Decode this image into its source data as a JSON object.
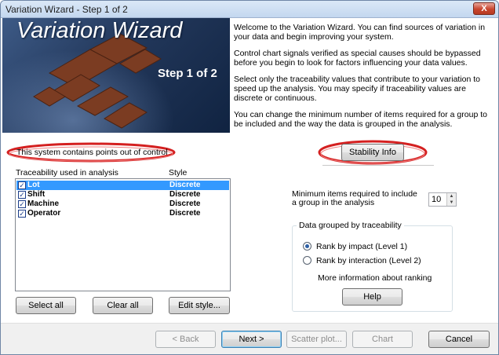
{
  "window": {
    "title": "Variation Wizard - Step 1 of 2",
    "close_glyph": "X"
  },
  "banner": {
    "title": "Variation Wizard",
    "step": "Step 1 of 2"
  },
  "intro": {
    "paragraphs": [
      "Welcome to the Variation Wizard.  You can find sources of variation in your data and begin improving your system.",
      "Control chart signals verified as special causes should be bypassed before you begin to look for factors influencing your data values.",
      "Select only the traceability values that contribute to your variation to speed up the analysis.  You may specify if traceability values are discrete or continuous.",
      "You can change the minimum number of items required for a group to be included and the way the data is grouped in the analysis."
    ]
  },
  "status": {
    "out_of_control": "This system contains points out of control"
  },
  "stability": {
    "button_label": "Stability Info"
  },
  "traceability": {
    "header_name": "Traceability used in analysis",
    "header_style": "Style",
    "items": [
      {
        "name": "Lot",
        "style": "Discrete",
        "checked": true,
        "selected": true
      },
      {
        "name": "Shift",
        "style": "Discrete",
        "checked": true,
        "selected": false
      },
      {
        "name": "Machine",
        "style": "Discrete",
        "checked": true,
        "selected": false
      },
      {
        "name": "Operator",
        "style": "Discrete",
        "checked": true,
        "selected": false
      }
    ],
    "check_glyph": "✓",
    "select_all": "Select all",
    "clear_all": "Clear all",
    "edit_style": "Edit style..."
  },
  "min_items": {
    "label": "Minimum items required to include a group in the analysis",
    "value": "10",
    "up_glyph": "▲",
    "down_glyph": "▼"
  },
  "grouping": {
    "legend": "Data grouped by traceability",
    "options": [
      {
        "label": "Rank by impact (Level 1)",
        "selected": true
      },
      {
        "label": "Rank by interaction (Level 2)",
        "selected": false
      }
    ],
    "more_info": "More information about ranking",
    "help_label": "Help"
  },
  "footer": {
    "back": "< Back",
    "next": "Next >",
    "scatter": "Scatter plot...",
    "chart": "Chart",
    "cancel": "Cancel"
  },
  "colors": {
    "highlight_red": "#d42020",
    "selection_blue": "#3399ff",
    "banner_dark_blue": "#1a2f52",
    "logo_brown": "#7b3c22"
  }
}
